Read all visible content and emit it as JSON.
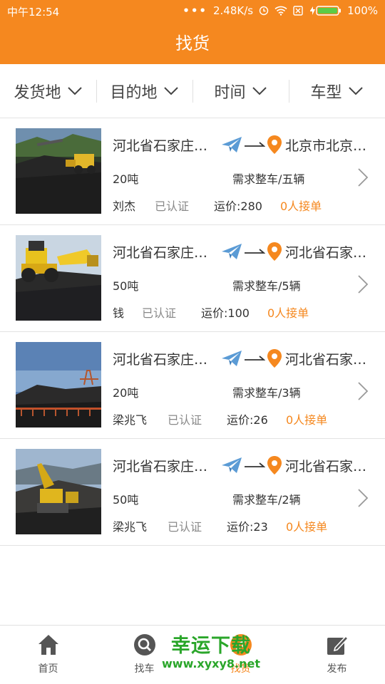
{
  "status_bar": {
    "time": "中午12:54",
    "dots": "•••",
    "speed": "2.48K/s",
    "battery": "100%"
  },
  "title": "找货",
  "filters": [
    "发货地",
    "目的地",
    "时间",
    "车型"
  ],
  "items": [
    {
      "origin": "河北省石家庄…",
      "destination": "北京市北京…",
      "weight": "20吨",
      "need": "需求整车/五辆",
      "driver": "刘杰",
      "cert": "已认证",
      "price": "运价:280",
      "orders": "0人接单"
    },
    {
      "origin": "河北省石家庄…",
      "destination": "河北省石家…",
      "weight": "50吨",
      "need": "需求整车/5辆",
      "driver": "钱",
      "cert": "已认证",
      "price": "运价:100",
      "orders": "0人接单"
    },
    {
      "origin": "河北省石家庄…",
      "destination": "河北省石家…",
      "weight": "20吨",
      "need": "需求整车/3辆",
      "driver": "梁兆飞",
      "cert": "已认证",
      "price": "运价:26",
      "orders": "0人接单"
    },
    {
      "origin": "河北省石家庄…",
      "destination": "河北省石家…",
      "weight": "50吨",
      "need": "需求整车/2辆",
      "driver": "梁兆飞",
      "cert": "已认证",
      "price": "运价:23",
      "orders": "0人接单"
    }
  ],
  "tabs": [
    {
      "label": "首页",
      "icon": "home-icon"
    },
    {
      "label": "找车",
      "icon": "search-icon"
    },
    {
      "label": "找货",
      "icon": "compass-icon"
    },
    {
      "label": "发布",
      "icon": "edit-icon"
    }
  ],
  "watermark": {
    "line1": "幸运下载",
    "line2": "www.xyxy8.net"
  },
  "colors": {
    "accent": "#f5881f",
    "plane": "#5b9bd5",
    "watermark": "#2aa62a"
  }
}
